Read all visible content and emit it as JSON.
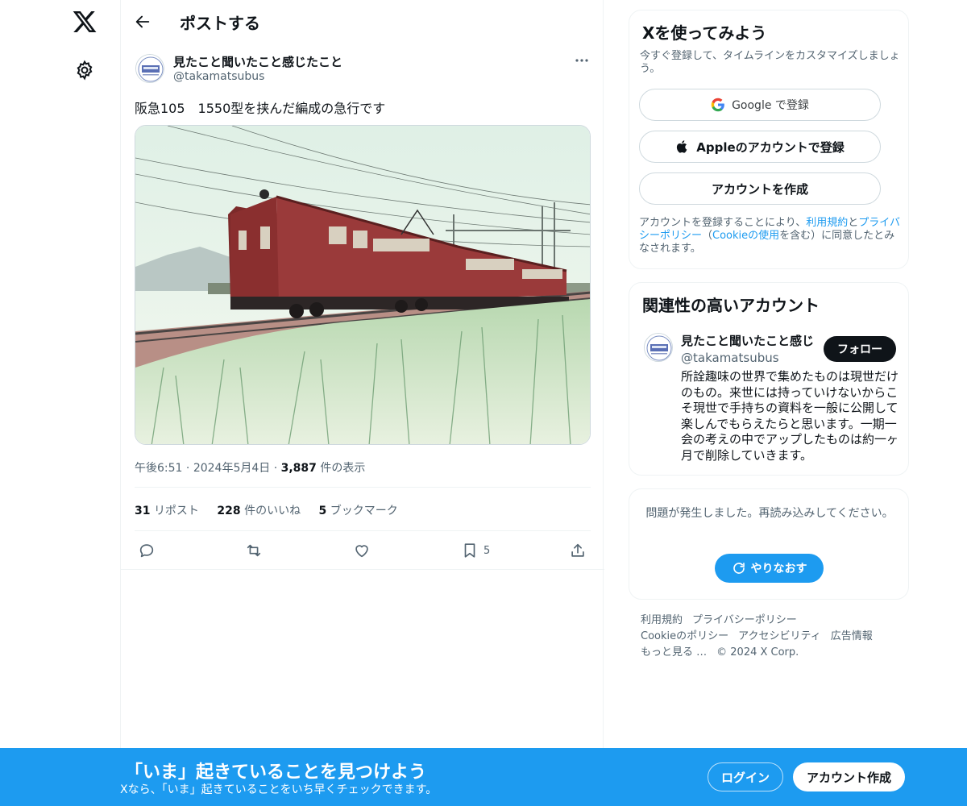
{
  "nav": {
    "logo_icon": "x-logo-icon",
    "settings_icon": "gear-icon"
  },
  "header": {
    "title": "ポストする",
    "back_icon": "arrow-left-icon"
  },
  "post": {
    "author_name": "見たこと聞いたこと感じたこと",
    "author_handle": "@takamatsubus",
    "more_icon": "more-icon",
    "text": "阪急105　1550型を挟んだ編成の急行です",
    "image_alt": "red vintage train passing through grassy field under overhead wires",
    "time": "午後6:51",
    "dot": "·",
    "date": "2024年5月4日",
    "views_count": "3,887",
    "views_label": "件の表示",
    "reposts_count": "31",
    "reposts_label": "リポスト",
    "likes_count": "228",
    "likes_label": "件のいいね",
    "bookmarks_count": "5",
    "bookmarks_label": "ブックマーク",
    "action_bookmark_count": "5"
  },
  "signup_card": {
    "title": "Xを使ってみよう",
    "subtitle": "今すぐ登録して、タイムラインをカスタマイズしましょう。",
    "google_label": "Google で登録",
    "apple_label": "Appleのアカウントで登録",
    "create_label": "アカウントを作成",
    "legal_prefix": "アカウントを登録することにより、",
    "legal_terms": "利用規約",
    "legal_and": "と",
    "legal_privacy": "プライバシーポリシー",
    "legal_open": "（",
    "legal_cookie": "Cookieの使用",
    "legal_suffix": "を含む）に同意したとみなされます。"
  },
  "related": {
    "title": "関連性の高いアカウント",
    "name": "見たこと聞いたこと感じ",
    "handle": "@takamatsubus",
    "follow_label": "フォロー",
    "bio": "所詮趣味の世界で集めたものは現世だけのもの。来世には持っていけないからこそ現世で手持ちの資料を一般に公開して楽しんでもらえたらと思います。一期一会の考えの中でアップしたものは約一ヶ月で削除していきます。"
  },
  "error_card": {
    "message": "問題が発生しました。再読み込みしてください。",
    "retry_label": "やりなおす"
  },
  "footer": {
    "links": [
      "利用規約",
      "プライバシーポリシー",
      "Cookieのポリシー",
      "アクセシビリティ",
      "広告情報",
      "もっと見る …",
      "© 2024 X Corp."
    ]
  },
  "bottom_bar": {
    "title": "「いま」起きていることを見つけよう",
    "subtitle": "Xなら、「いま」起きていることをいち早くチェックできます。",
    "login_label": "ログイン",
    "signup_label": "アカウント作成"
  },
  "colors": {
    "accent": "#1d9bf0",
    "text": "#0f1419",
    "muted": "#536471",
    "border": "#eff3f4"
  }
}
